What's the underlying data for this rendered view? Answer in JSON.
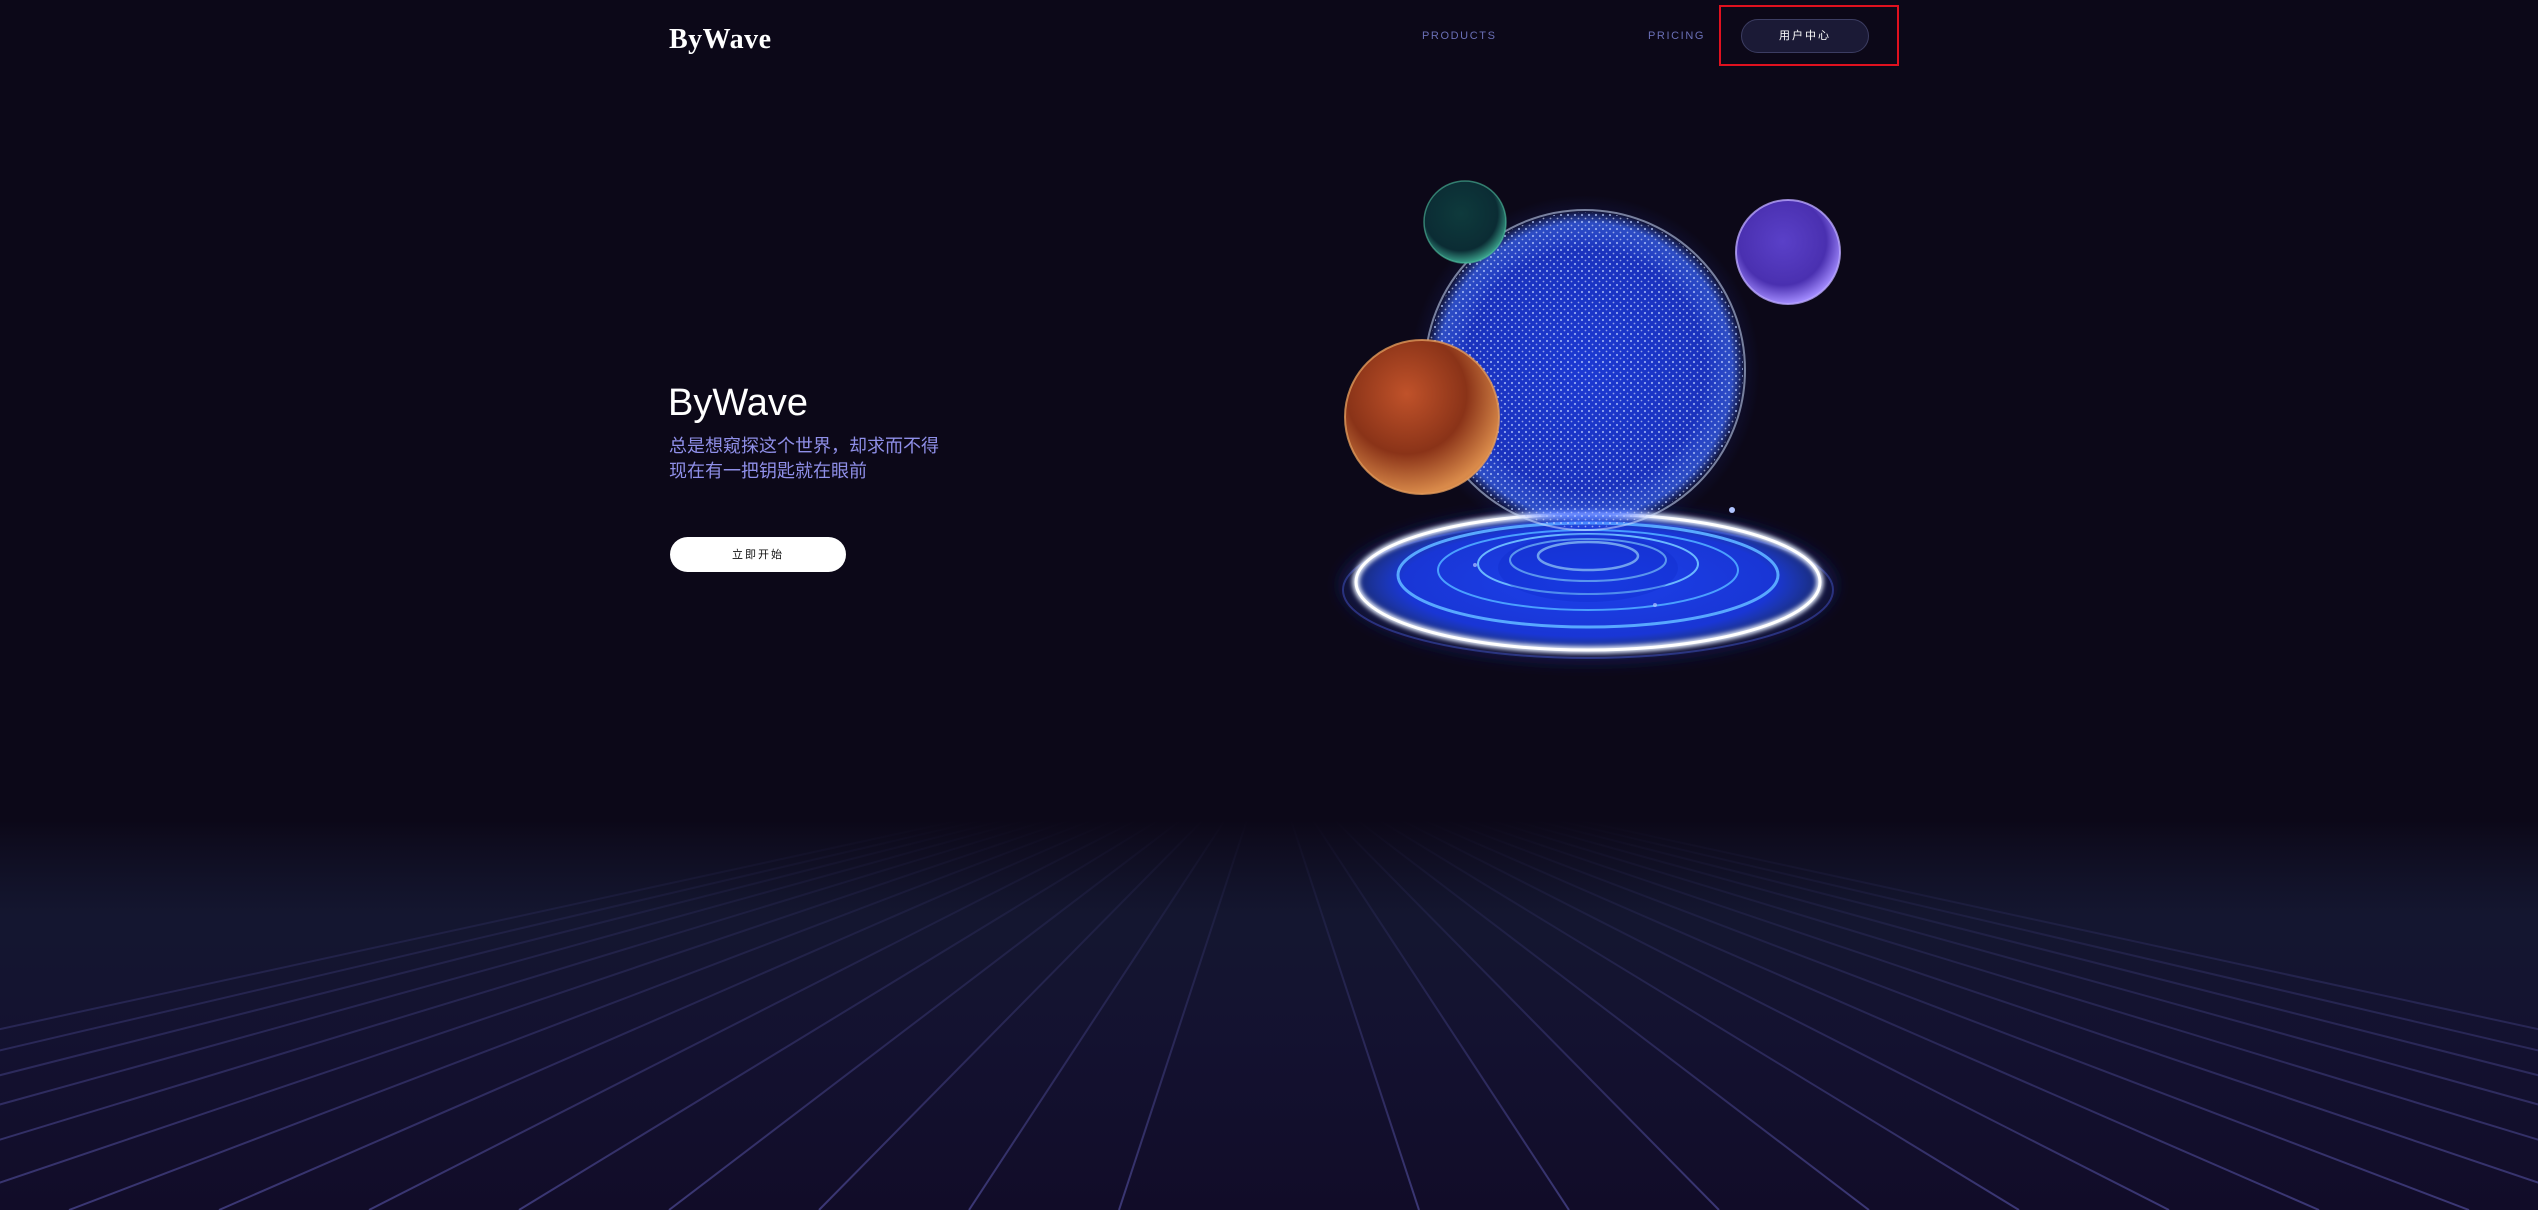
{
  "header": {
    "logo": "ByWave",
    "nav": {
      "products": "PRODUCTS",
      "pricing": "PRICING",
      "user_center": "用户中心"
    }
  },
  "hero": {
    "title": "ByWave",
    "subtitle_line1": "总是想窥探这个世界，却求而不得",
    "subtitle_line2": "现在有一把钥匙就在眼前",
    "cta": "立即开始"
  },
  "colors": {
    "background": "#0c0818",
    "accent_blue": "#2a4bff",
    "nav_link": "#6a6fb6",
    "subtitle": "#8f8fe8",
    "highlight": "#e0111f"
  },
  "icons": {
    "hero_illustration": "glowing-sphere-platform-illustration",
    "orbs": [
      "green-orb",
      "purple-orb",
      "orange-orb"
    ]
  }
}
